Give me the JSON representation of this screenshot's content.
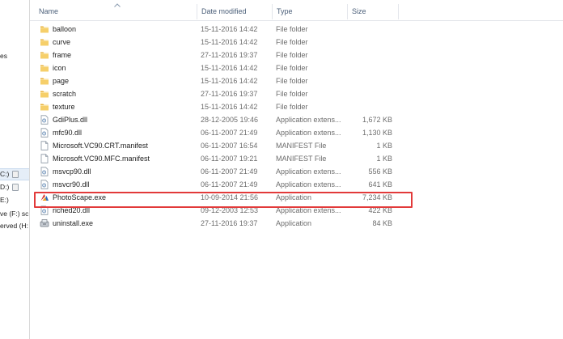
{
  "nav_pane": {
    "items": [
      {
        "label": "es",
        "selected": false,
        "icon": "none"
      },
      {
        "label": "C:)",
        "selected": true,
        "icon": "drive-icon"
      },
      {
        "label": "D:)",
        "selected": false,
        "icon": "drive-icon"
      },
      {
        "label": "E:)",
        "selected": false,
        "icon": "drive-icon"
      },
      {
        "label": "ve (F:) sc",
        "selected": false,
        "icon": "drive-icon"
      },
      {
        "label": "erved (H:",
        "selected": false,
        "icon": "drive-icon"
      }
    ]
  },
  "columns": {
    "name": "Name",
    "date_modified": "Date modified",
    "type": "Type",
    "size": "Size"
  },
  "sort": {
    "column": "name",
    "direction": "ascending"
  },
  "files": [
    {
      "name": "balloon",
      "date": "15-11-2016 14:42",
      "type": "File folder",
      "size": "",
      "icon": "folder-icon"
    },
    {
      "name": "curve",
      "date": "15-11-2016 14:42",
      "type": "File folder",
      "size": "",
      "icon": "folder-icon"
    },
    {
      "name": "frame",
      "date": "27-11-2016 19:37",
      "type": "File folder",
      "size": "",
      "icon": "folder-icon"
    },
    {
      "name": "icon",
      "date": "15-11-2016 14:42",
      "type": "File folder",
      "size": "",
      "icon": "folder-icon"
    },
    {
      "name": "page",
      "date": "15-11-2016 14:42",
      "type": "File folder",
      "size": "",
      "icon": "folder-icon"
    },
    {
      "name": "scratch",
      "date": "27-11-2016 19:37",
      "type": "File folder",
      "size": "",
      "icon": "folder-icon"
    },
    {
      "name": "texture",
      "date": "15-11-2016 14:42",
      "type": "File folder",
      "size": "",
      "icon": "folder-icon"
    },
    {
      "name": "GdiPlus.dll",
      "date": "28-12-2005 19:46",
      "type": "Application extens...",
      "size": "1,672 KB",
      "icon": "dll-icon"
    },
    {
      "name": "mfc90.dll",
      "date": "06-11-2007 21:49",
      "type": "Application extens...",
      "size": "1,130 KB",
      "icon": "dll-icon"
    },
    {
      "name": "Microsoft.VC90.CRT.manifest",
      "date": "06-11-2007 16:54",
      "type": "MANIFEST File",
      "size": "1 KB",
      "icon": "file-icon"
    },
    {
      "name": "Microsoft.VC90.MFC.manifest",
      "date": "06-11-2007 19:21",
      "type": "MANIFEST File",
      "size": "1 KB",
      "icon": "file-icon"
    },
    {
      "name": "msvcp90.dll",
      "date": "06-11-2007 21:49",
      "type": "Application extens...",
      "size": "556 KB",
      "icon": "dll-icon"
    },
    {
      "name": "msvcr90.dll",
      "date": "06-11-2007 21:49",
      "type": "Application extens...",
      "size": "641 KB",
      "icon": "dll-icon"
    },
    {
      "name": "PhotoScape.exe",
      "date": "10-09-2014 21:56",
      "type": "Application",
      "size": "7,234 KB",
      "icon": "photoscape-icon",
      "highlighted": true
    },
    {
      "name": "riched20.dll",
      "date": "09-12-2003 12:53",
      "type": "Application extens...",
      "size": "422 KB",
      "icon": "dll-icon"
    },
    {
      "name": "uninstall.exe",
      "date": "27-11-2016 19:37",
      "type": "Application",
      "size": "84 KB",
      "icon": "uninstall-icon"
    }
  ],
  "colors": {
    "highlight_border": "#e23a3a",
    "header_text": "#4c607a",
    "folder_yellow": "#f2c55c",
    "selected_nav": "#e5eef8"
  }
}
